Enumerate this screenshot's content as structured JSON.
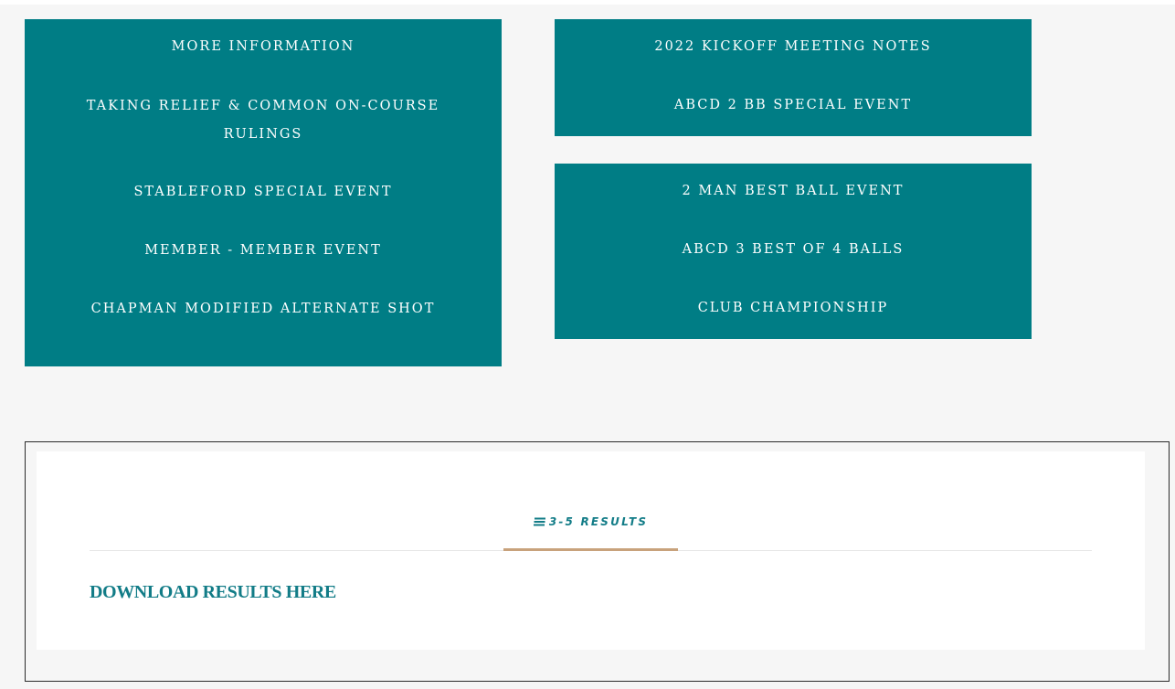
{
  "menus": {
    "left": [
      "MORE INFORMATION",
      "TAKING RELIEF & COMMON ON-COURSE RULINGS",
      "STABLEFORD SPECIAL EVENT",
      "MEMBER - MEMBER EVENT",
      "CHAPMAN MODIFIED ALTERNATE SHOT"
    ],
    "right_top": [
      "2022 KICKOFF MEETING NOTES",
      "ABCD 2 BB SPECIAL EVENT"
    ],
    "right_bottom": [
      "2 MAN BEST BALL EVENT",
      "ABCD 3 BEST OF 4 BALLS",
      "CLUB CHAMPIONSHIP"
    ]
  },
  "results": {
    "tab_label": "3-5 RESULTS",
    "tab_icon": "list-icon",
    "download_label": "DOWNLOAD RESULTS HERE"
  },
  "colors": {
    "teal": "#007d85",
    "link_teal": "#127c87",
    "accent_tan": "#c8a27c",
    "page_bg": "#f6f6f6"
  }
}
